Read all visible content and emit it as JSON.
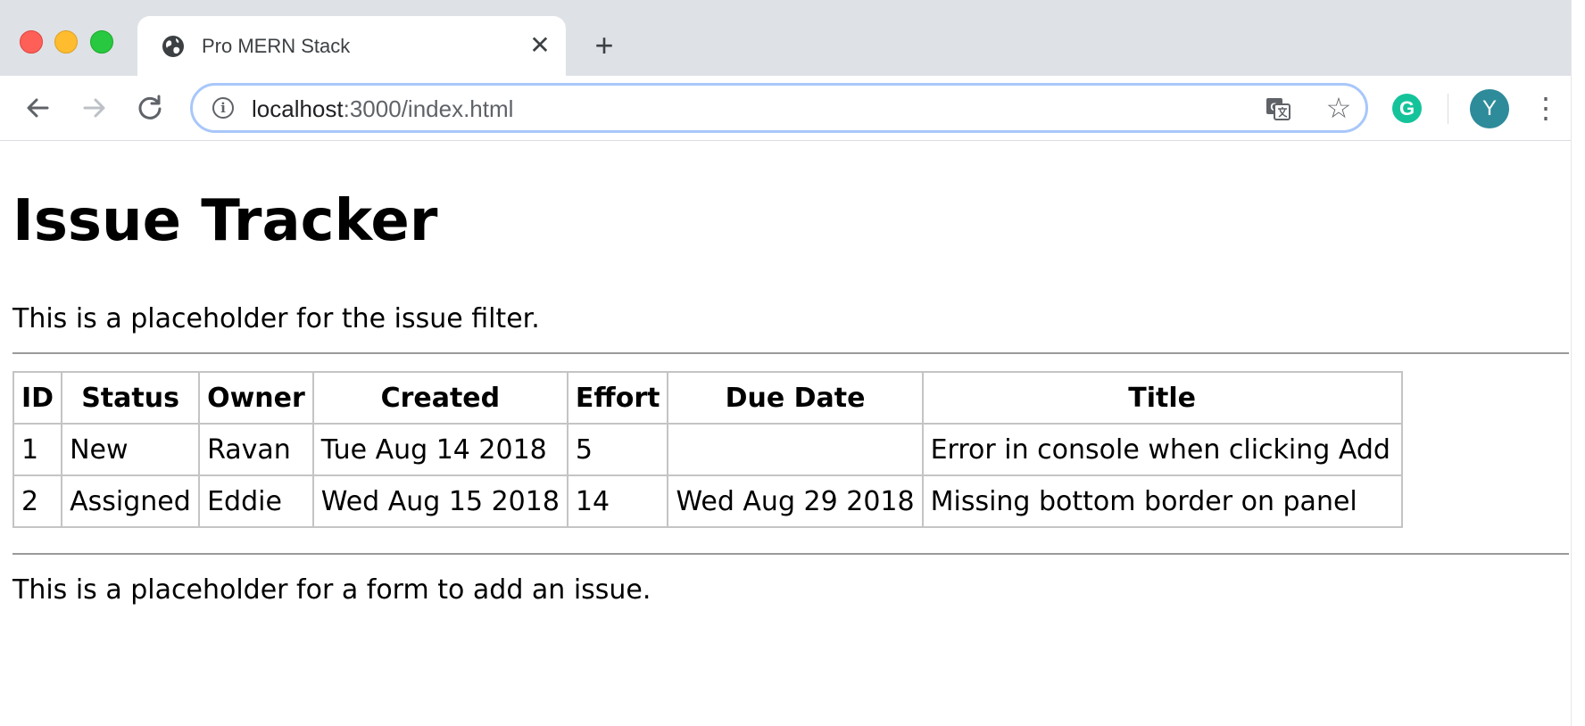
{
  "browser": {
    "tab": {
      "title": "Pro MERN Stack",
      "favicon": "globe-icon"
    },
    "new_tab_label": "+",
    "url_host": "localhost",
    "url_path": ":3000/index.html",
    "avatar_initial": "Y",
    "grammarly_letter": "G",
    "colors": {
      "tabstrip": "#dee1e6",
      "omnibox_focus": "#a8c7fa",
      "avatar": "#2e8b9a",
      "grammarly": "#15c39a"
    },
    "icons": [
      "back-arrow-icon",
      "forward-arrow-icon",
      "reload-icon",
      "info-icon",
      "translate-icon",
      "star-icon",
      "grammarly-icon",
      "kebab-menu-icon",
      "close-icon"
    ]
  },
  "page": {
    "title": "Issue Tracker",
    "filter_placeholder": "This is a placeholder for the issue filter.",
    "add_placeholder": "This is a placeholder for a form to add an issue."
  },
  "table": {
    "headers": [
      "ID",
      "Status",
      "Owner",
      "Created",
      "Effort",
      "Due Date",
      "Title"
    ],
    "rows": [
      [
        "1",
        "New",
        "Ravan",
        "Tue Aug 14 2018",
        "5",
        "",
        "Error in console when clicking Add"
      ],
      [
        "2",
        "Assigned",
        "Eddie",
        "Wed Aug 15 2018",
        "14",
        "Wed Aug 29 2018",
        "Missing bottom border on panel"
      ]
    ]
  }
}
